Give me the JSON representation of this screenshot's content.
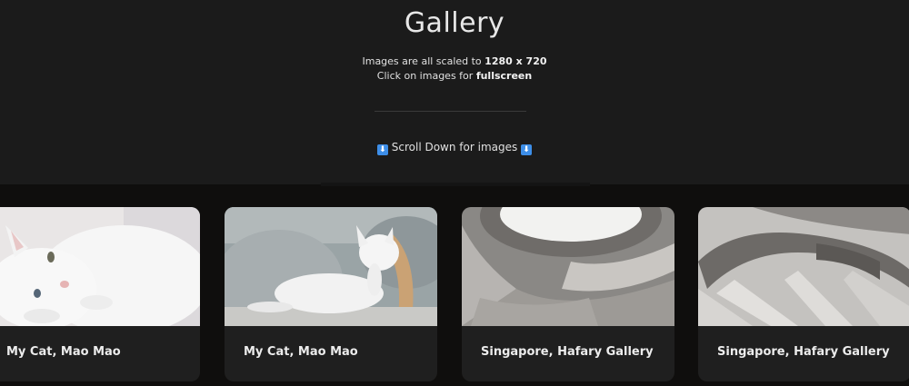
{
  "header": {
    "title": "Gallery",
    "line1_prefix": "Images are all scaled to ",
    "line1_bold": "1280 x 720",
    "line2_prefix": "Click on images for ",
    "line2_bold": "fullscreen",
    "scroll_hint": "Scroll Down for images",
    "scroll_icon": "⬇"
  },
  "gallery": {
    "items": [
      {
        "caption": "My Cat, Mao Mao",
        "image": "white-cat-lying-photo"
      },
      {
        "caption": "My Cat, Mao Mao",
        "image": "white-cat-on-chair-photo"
      },
      {
        "caption": "Singapore, Hafary Gallery",
        "image": "architecture-curves-photo"
      },
      {
        "caption": "Singapore, Hafary Gallery",
        "image": "spiral-staircase-photo"
      }
    ]
  },
  "colors": {
    "header_bg": "#1b1b1b",
    "page_bg": "#0f0e0d",
    "card_bg": "#1f1f1f",
    "icon_blue": "#3d8ee8"
  }
}
